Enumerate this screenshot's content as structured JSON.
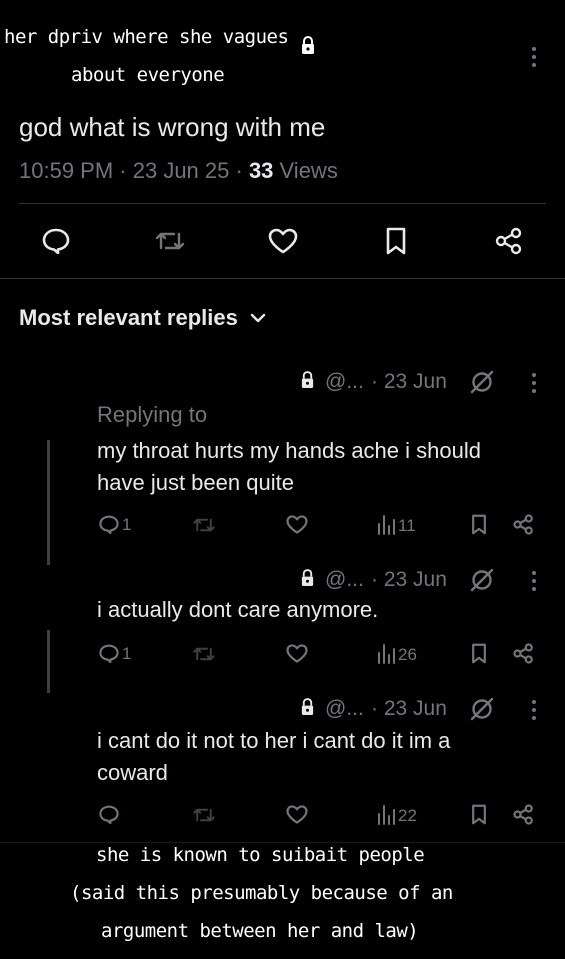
{
  "caption_top": {
    "line1": "her dpriv where she vagues",
    "line2": "about everyone"
  },
  "tweet": {
    "text": "god what is wrong with me",
    "time": "10:59 PM",
    "sep1": " · ",
    "date": "23 Jun 25",
    "sep2": " · ",
    "views_count": "33",
    "views_label": " Views"
  },
  "replies_header": "Most relevant replies",
  "replies": [
    {
      "handle": "@...",
      "date": "· 23 Jun",
      "replying_to": "Replying to",
      "text_lines": [
        "my throat hurts my hands ache i should",
        "have just been quite"
      ],
      "reply_count": "1",
      "views": "11"
    },
    {
      "handle": "@...",
      "date": "· 23 Jun",
      "text_lines": [
        "i actually dont care anymore."
      ],
      "reply_count": "1",
      "views": "26"
    },
    {
      "handle": "@...",
      "date": "· 23 Jun",
      "text_lines": [
        "i cant do it not to her i cant do it im a",
        "coward"
      ],
      "reply_count": "",
      "views": "22"
    }
  ],
  "caption_bottom": {
    "line1": "she is known to suibait people",
    "line2": "(said this presumably because of an",
    "line3": "argument between her and law)"
  },
  "colors": {
    "background": "#000000",
    "text": "#e7e9ea",
    "muted": "#71767b",
    "divider": "#2f3336"
  }
}
